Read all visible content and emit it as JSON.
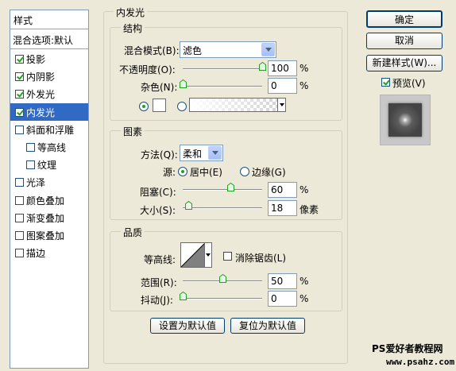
{
  "left_panel": {
    "header": "样式",
    "blend_options": "混合选项:默认",
    "items": [
      {
        "label": "投影",
        "checked": true,
        "sub": false,
        "active": false
      },
      {
        "label": "内阴影",
        "checked": true,
        "sub": false,
        "active": false
      },
      {
        "label": "外发光",
        "checked": true,
        "sub": false,
        "active": false
      },
      {
        "label": "内发光",
        "checked": true,
        "sub": false,
        "active": true
      },
      {
        "label": "斜面和浮雕",
        "checked": false,
        "sub": false,
        "active": false
      },
      {
        "label": "等高线",
        "checked": false,
        "sub": true,
        "active": false
      },
      {
        "label": "纹理",
        "checked": false,
        "sub": true,
        "active": false
      },
      {
        "label": "光泽",
        "checked": false,
        "sub": false,
        "active": false
      },
      {
        "label": "颜色叠加",
        "checked": false,
        "sub": false,
        "active": false
      },
      {
        "label": "渐变叠加",
        "checked": false,
        "sub": false,
        "active": false
      },
      {
        "label": "图案叠加",
        "checked": false,
        "sub": false,
        "active": false
      },
      {
        "label": "描边",
        "checked": false,
        "sub": false,
        "active": false
      }
    ]
  },
  "inner_glow": {
    "title": "内发光",
    "structure": {
      "title": "结构",
      "blend_mode_label": "混合模式(B):",
      "blend_mode_value": "滤色",
      "opacity_label": "不透明度(O):",
      "opacity_value": "100",
      "opacity_level": 100,
      "noise_label": "杂色(N):",
      "noise_value": "0",
      "noise_level": 0,
      "percent": "%"
    },
    "elements": {
      "title": "图素",
      "technique_label": "方法(Q):",
      "technique_value": "柔和",
      "source_label": "源:",
      "source_center": "居中(E)",
      "source_edge": "边缘(G)",
      "choke_label": "阻塞(C):",
      "choke_value": "60",
      "choke_level": 60,
      "size_label": "大小(S):",
      "size_value": "18",
      "size_level": 7,
      "size_unit": "像素",
      "percent": "%"
    },
    "quality": {
      "title": "品质",
      "contour_label": "等高线:",
      "antialias_label": "消除锯齿(L)",
      "range_label": "范围(R):",
      "range_value": "50",
      "range_level": 50,
      "jitter_label": "抖动(J):",
      "jitter_value": "0",
      "jitter_level": 0,
      "percent": "%"
    },
    "make_default": "设置为默认值",
    "reset_default": "复位为默认值"
  },
  "right_panel": {
    "ok": "确定",
    "cancel": "取消",
    "new_style": "新建样式(W)...",
    "preview_label": "预览(V)",
    "preview_checked": true
  },
  "watermark": {
    "line1": "PS爱好者教程网",
    "line2": "www.psahz.com"
  },
  "colors": {
    "accent": "#316ac5",
    "dialog_bg": "#ece9d8",
    "thumb_green": "#21a121"
  }
}
